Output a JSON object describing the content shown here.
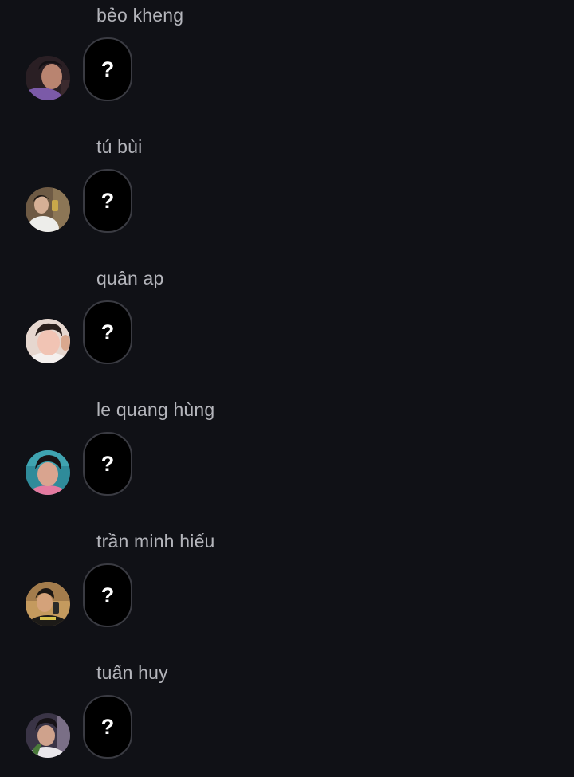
{
  "conversation": {
    "messages": [
      {
        "sender": "bẻo kheng",
        "content": "?"
      },
      {
        "sender": "tú bùi",
        "content": "?"
      },
      {
        "sender": "quân ap",
        "content": "?"
      },
      {
        "sender": "le quang hùng",
        "content": "?"
      },
      {
        "sender": "trần minh hiếu",
        "content": "?"
      },
      {
        "sender": "tuấn huy",
        "content": "?"
      }
    ]
  },
  "colors": {
    "background": "#101116",
    "sender_name": "#b4b5bb",
    "bubble_fill": "#000000",
    "bubble_border": "#3a3b42",
    "bubble_text": "#ffffff"
  }
}
